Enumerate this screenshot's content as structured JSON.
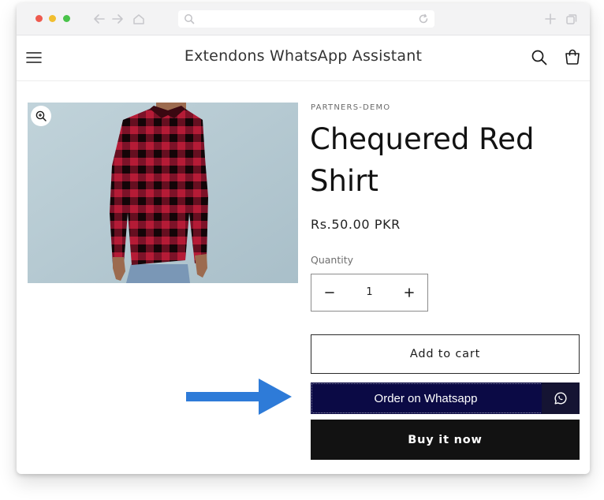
{
  "browser": {
    "url_placeholder": "",
    "icons": [
      "back-arrow-icon",
      "forward-arrow-icon",
      "home-icon",
      "search-icon",
      "reload-icon",
      "new-tab-plus-icon",
      "tabs-icon"
    ]
  },
  "header": {
    "store_name": "Extendons WhatsApp Assistant",
    "icons": [
      "menu-icon",
      "search-icon",
      "cart-icon"
    ]
  },
  "product": {
    "vendor": "PARTNERS-DEMO",
    "title": "Chequered Red Shirt",
    "price": "Rs.50.00 PKR",
    "quantity_label": "Quantity",
    "quantity_value": "1",
    "minus_symbol": "−",
    "plus_symbol": "+",
    "image_icon": "zoom-in-icon"
  },
  "actions": {
    "add_to_cart": "Add to cart",
    "order_whatsapp": "Order on Whatsapp",
    "whatsapp_icon": "whatsapp-icon",
    "buy_now": "Buy it now"
  },
  "annotation": {
    "arrow_color": "#2e7bd8",
    "arrow_icon": "right-arrow-icon"
  },
  "colors": {
    "whatsapp_button_bg": "#0b0a45",
    "buy_button_bg": "#121212",
    "shirt_red": "#b51b36"
  }
}
